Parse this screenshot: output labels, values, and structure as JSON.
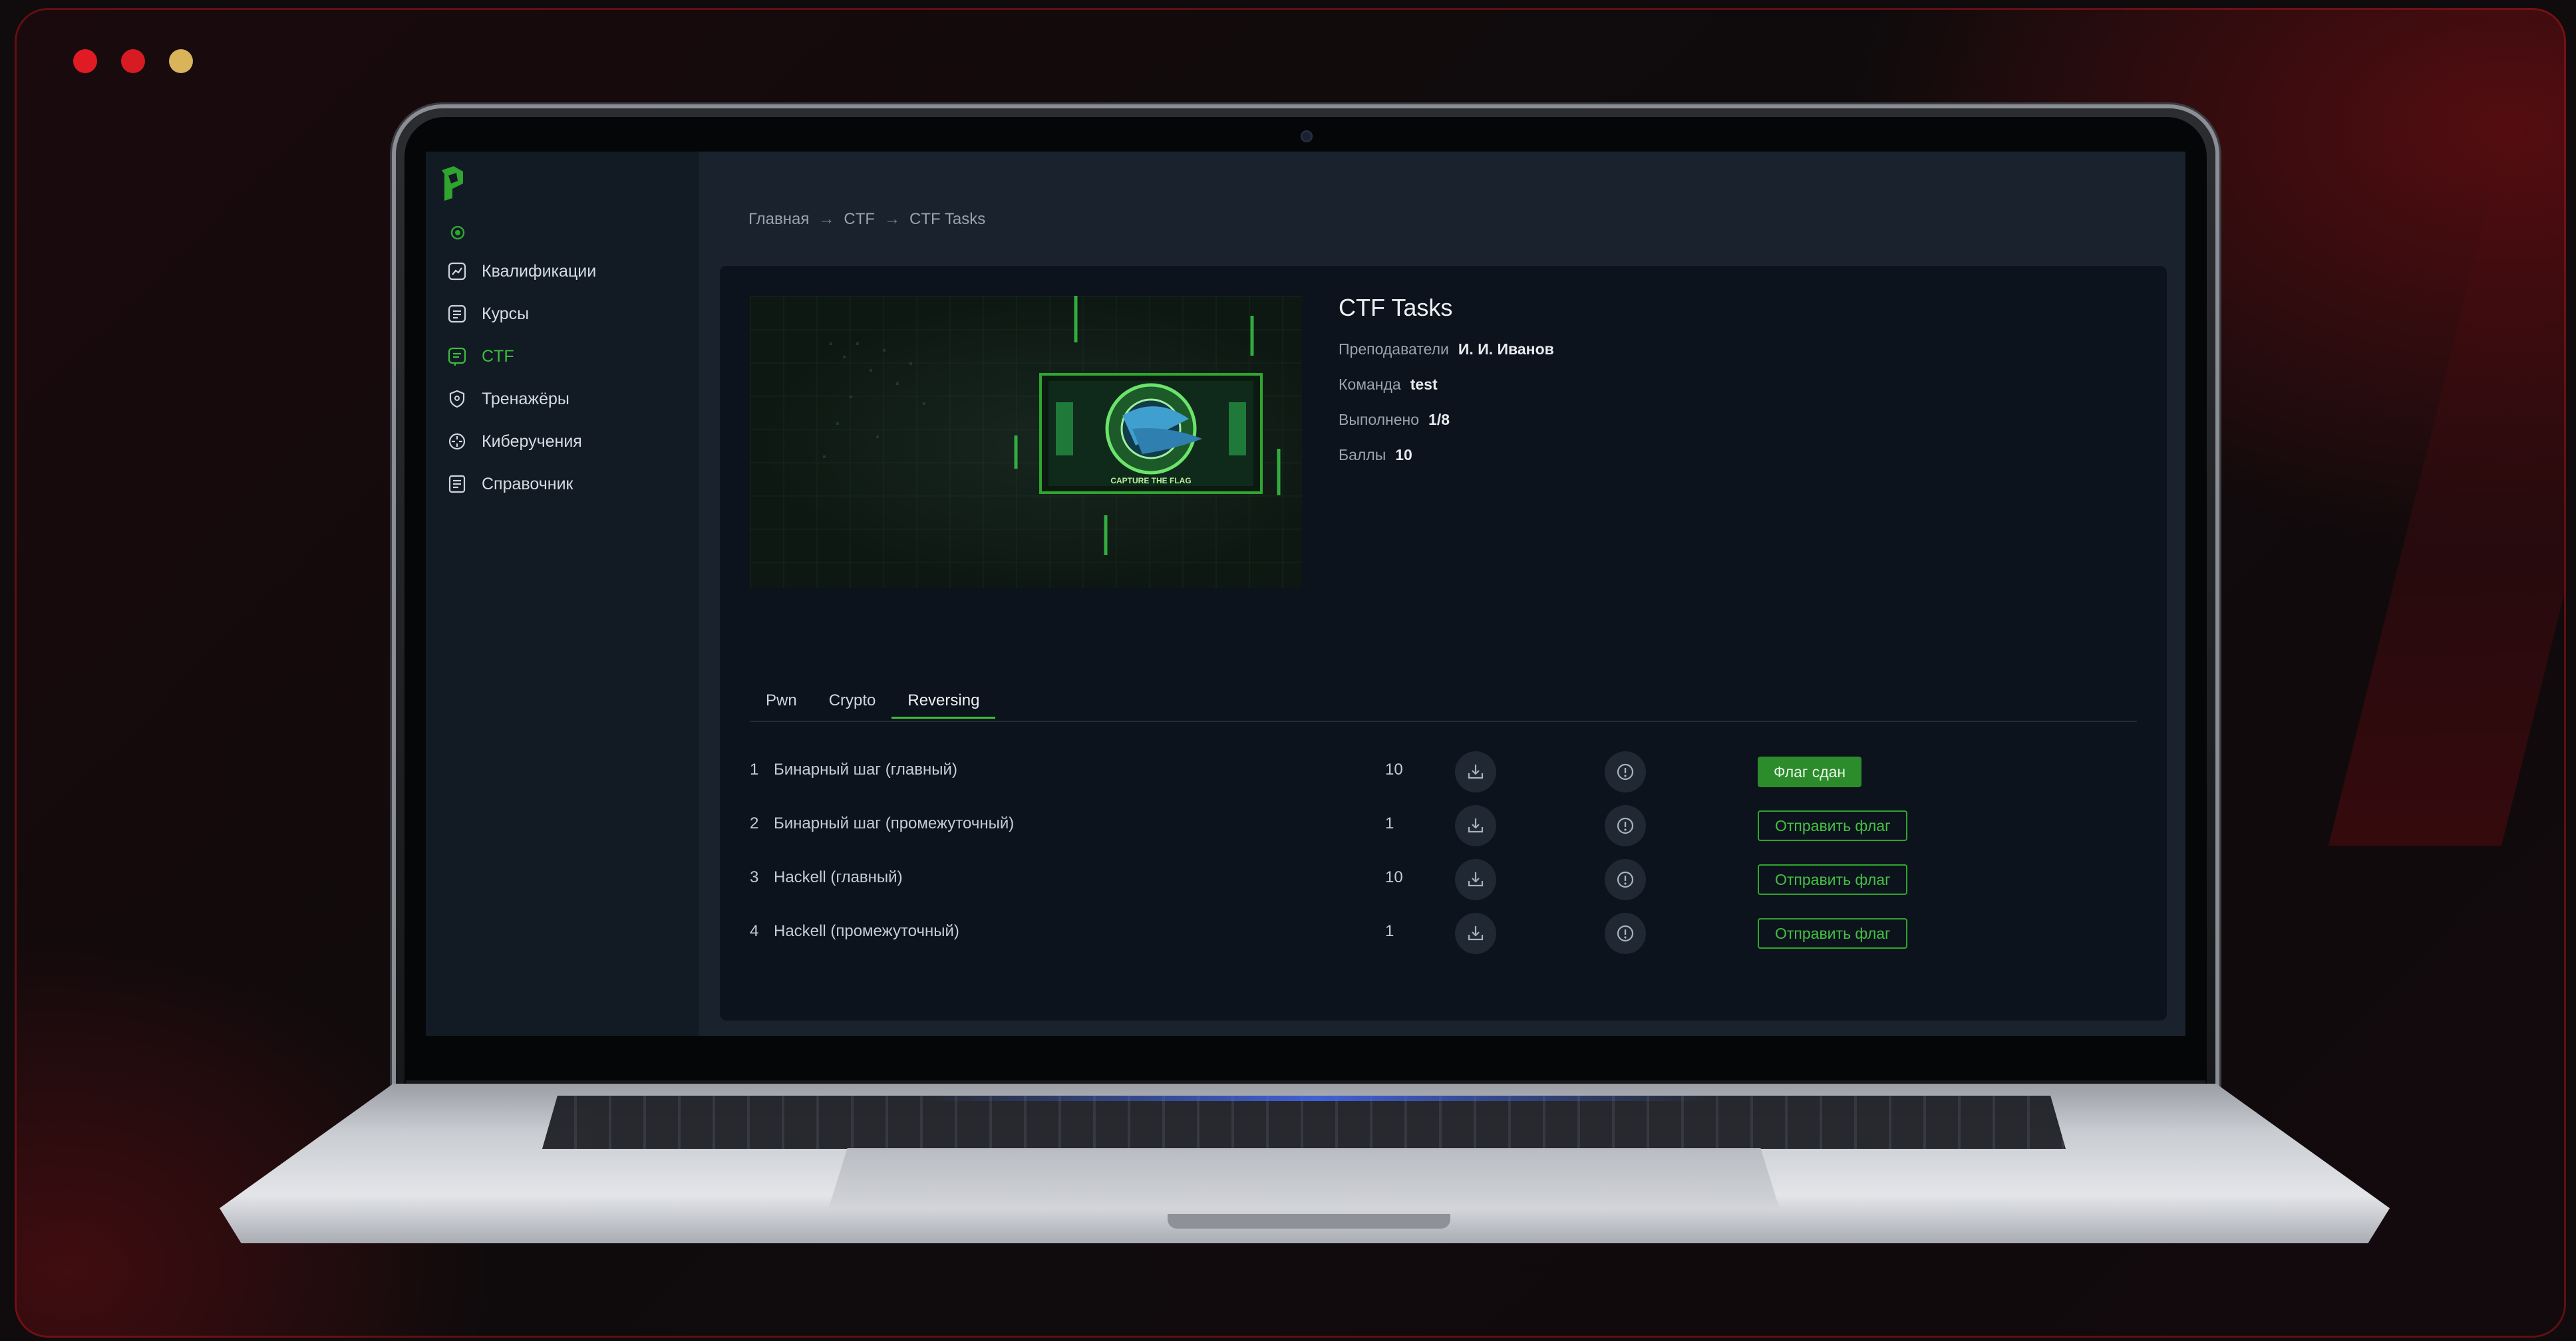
{
  "sidebar": {
    "items": [
      {
        "label": "Квалификации",
        "icon": "chart-icon"
      },
      {
        "label": "Курсы",
        "icon": "book-icon"
      },
      {
        "label": "CTF",
        "icon": "flag-icon",
        "active": true
      },
      {
        "label": "Тренажёры",
        "icon": "shield-icon"
      },
      {
        "label": "Киберучения",
        "icon": "target-icon"
      },
      {
        "label": "Справочник",
        "icon": "reference-icon"
      }
    ]
  },
  "breadcrumb": [
    "Главная",
    "CTF",
    "CTF Tasks"
  ],
  "breadcrumb_separator": "→",
  "course": {
    "title": "CTF Tasks",
    "teachers_label": "Преподаватели",
    "teachers_value": "И. И. Иванов",
    "team_label": "Команда",
    "team_value": "test",
    "done_label": "Выполнено",
    "done_value": "1/8",
    "points_label": "Баллы",
    "points_value": "10",
    "banner_caption": "CAPTURE THE FLAG"
  },
  "tabs": [
    {
      "label": "Pwn"
    },
    {
      "label": "Crypto"
    },
    {
      "label": "Reversing",
      "active": true
    }
  ],
  "tasks": [
    {
      "num": "1",
      "name": "Бинарный шаг (главный)",
      "points": "10",
      "action": "Флаг сдан",
      "submitted": true
    },
    {
      "num": "2",
      "name": "Бинарный шаг (промежуточный)",
      "points": "1",
      "action": "Отправить флаг",
      "submitted": false
    },
    {
      "num": "3",
      "name": "Hackell (главный)",
      "points": "10",
      "action": "Отправить флаг",
      "submitted": false
    },
    {
      "num": "4",
      "name": "Hackell (промежуточный)",
      "points": "1",
      "action": "Отправить флаг",
      "submitted": false
    }
  ],
  "colors": {
    "accent": "#3bbf3b",
    "window_dot_red": "#e01b24",
    "window_dot_yellow": "#d9b45a",
    "background": "#100b0d"
  }
}
